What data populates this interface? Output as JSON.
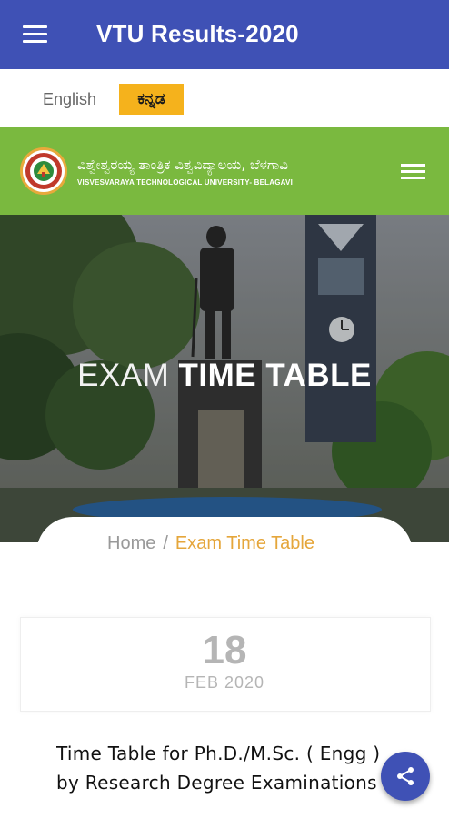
{
  "app_bar": {
    "title": "VTU Results-2020",
    "color": "#3f51b5",
    "menu_icon": "hamburger-menu-icon"
  },
  "language": {
    "english": "English",
    "kannada": "ಕನ್ನಡ",
    "selected": "kannada",
    "selected_color": "#f5b21c"
  },
  "university": {
    "name_kannada": "ವಿಶ್ವೇಶ್ವರಯ್ಯ ತಾಂತ್ರಿಕ ವಿಶ್ವವಿದ್ಯಾಲಯ, ಬೆಳಗಾವಿ",
    "name_english": "VISVESVARAYA TECHNOLOGICAL UNIVERSITY- BELAGAVI",
    "logo_icon": "vtu-logo-icon",
    "menu_icon": "hamburger-menu-icon",
    "bar_color": "#7ab93f"
  },
  "hero": {
    "title_light": "EXAM",
    "title_bold": "TIME TABLE"
  },
  "breadcrumb": {
    "home": "Home",
    "separator": "/",
    "current": "Exam Time Table",
    "current_color": "#e5a63b"
  },
  "post": {
    "day": "18",
    "month_year": "FEB 2020",
    "title_line1": "Time Table for Ph.D./M.Sc. ( Engg )",
    "title_line2": "by Research Degree Examinations"
  },
  "fab": {
    "icon": "share-icon",
    "color": "#3f51b5"
  }
}
